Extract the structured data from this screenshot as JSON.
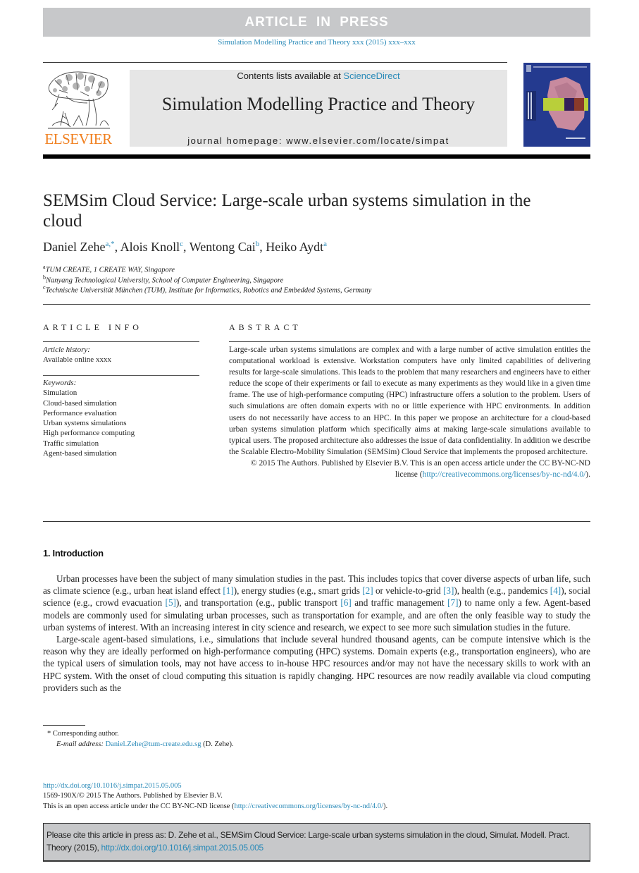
{
  "banner": {
    "label": "ARTICLE IN PRESS",
    "journal_ref": "Simulation Modelling Practice and Theory xxx (2015) xxx–xxx"
  },
  "masthead": {
    "publisher": "ELSEVIER",
    "contents_prefix": "Contents lists available at ",
    "contents_link": "ScienceDirect",
    "journal_title": "Simulation Modelling Practice and Theory",
    "homepage": "journal homepage: www.elsevier.com/locate/simpat",
    "colors": {
      "accent_link": "#2a8ab8",
      "publisher_orange": "#f07f1e",
      "cover_blue": "#243a8f",
      "banner_gray": "#c7c8ca"
    }
  },
  "article": {
    "title": "SEMSim Cloud Service: Large-scale urban systems simulation in the cloud",
    "authors": [
      {
        "name": "Daniel Zehe",
        "marks": "a,*"
      },
      {
        "name": "Alois Knoll",
        "marks": "c"
      },
      {
        "name": "Wentong Cai",
        "marks": "b"
      },
      {
        "name": "Heiko Aydt",
        "marks": "a"
      }
    ],
    "affiliations": [
      {
        "mark": "a",
        "text": "TUM CREATE, 1 CREATE WAY, Singapore"
      },
      {
        "mark": "b",
        "text": "Nanyang Technological University, School of Computer Engineering, Singapore"
      },
      {
        "mark": "c",
        "text": "Technische Universität München (TUM), Institute for Informatics, Robotics and Embedded Systems, Germany"
      }
    ]
  },
  "article_info": {
    "heading": "ARTICLE INFO",
    "history_label": "Article history:",
    "history_value": "Available online xxxx",
    "keywords_label": "Keywords:",
    "keywords": [
      "Simulation",
      "Cloud-based simulation",
      "Performance evaluation",
      "Urban systems simulations",
      "High performance computing",
      "Traffic simulation",
      "Agent-based simulation"
    ]
  },
  "abstract": {
    "heading": "ABSTRACT",
    "text": "Large-scale urban systems simulations are complex and with a large number of active simulation entities the computational workload is extensive. Workstation computers have only limited capabilities of delivering results for large-scale simulations. This leads to the problem that many researchers and engineers have to either reduce the scope of their experiments or fail to execute as many experiments as they would like in a given time frame. The use of high-performance computing (HPC) infrastructure offers a solution to the problem. Users of such simulations are often domain experts with no or little experience with HPC environments. In addition users do not necessarily have access to an HPC. In this paper we propose an architecture for a cloud-based urban systems simulation platform which specifically aims at making large-scale simulations available to typical users. The proposed architecture also addresses the issue of data confidentiality. In addition we describe the Scalable Electro-Mobility Simulation (SEMSim) Cloud Service that implements the proposed architecture.",
    "copyright_prefix": "© 2015 The Authors. Published by Elsevier B.V. This is an open access article under the CC BY-NC-ND license (",
    "license_link": "http://creativecommons.org/licenses/by-nc-nd/4.0/",
    "copyright_suffix": ")."
  },
  "introduction": {
    "heading": "1. Introduction",
    "p1": [
      {
        "t": "Urban processes have been the subject of many simulation studies in the past. This includes topics that cover diverse aspects of urban life, such as climate science (e.g., urban heat island effect "
      },
      {
        "ref": "[1]"
      },
      {
        "t": "), energy studies (e.g., smart grids "
      },
      {
        "ref": "[2]"
      },
      {
        "t": " or vehicle-to-grid "
      },
      {
        "ref": "[3]"
      },
      {
        "t": "), health (e.g., pandemics "
      },
      {
        "ref": "[4]"
      },
      {
        "t": "), social science (e.g., crowd evacuation "
      },
      {
        "ref": "[5]"
      },
      {
        "t": "), and transportation (e.g., public transport "
      },
      {
        "ref": "[6]"
      },
      {
        "t": " and traffic management "
      },
      {
        "ref": "[7]"
      },
      {
        "t": ") to name only a few. Agent-based models are commonly used for simulating urban processes, such as transportation for example, and are often the only feasible way to study the urban systems of interest. With an increasing interest in city science and research, we expect to see more such simulation studies in the future."
      }
    ],
    "p2": "Large-scale agent-based simulations, i.e., simulations that include several hundred thousand agents, can be compute intensive which is the reason why they are ideally performed on high-performance computing (HPC) systems. Domain experts (e.g., transportation engineers), who are the typical users of simulation tools, may not have access to in-house HPC resources and/or may not have the necessary skills to work with an HPC system. With the onset of cloud computing this situation is rapidly changing. HPC resources are now readily available via cloud computing providers such as the"
  },
  "footnotes": {
    "corresponding": "* Corresponding author.",
    "email_label": "E-mail address:",
    "email": "Daniel.Zehe@tum-create.edu.sg",
    "email_suffix": " (D. Zehe)."
  },
  "doi_block": {
    "doi": "http://dx.doi.org/10.1016/j.simpat.2015.05.005",
    "issn_line": "1569-190X/© 2015 The Authors. Published by Elsevier B.V.",
    "license_prefix": "This is an open access article under the CC BY-NC-ND license (",
    "license_link": "http://creativecommons.org/licenses/by-nc-nd/4.0/",
    "license_suffix": ")."
  },
  "citation": {
    "text": "Please cite this article in press as: D. Zehe et al., SEMSim Cloud Service: Large-scale urban systems simulation  in the cloud, Simulat. Modell. Pract. Theory (2015), ",
    "link": "http://dx.doi.org/10.1016/j.simpat.2015.05.005"
  }
}
